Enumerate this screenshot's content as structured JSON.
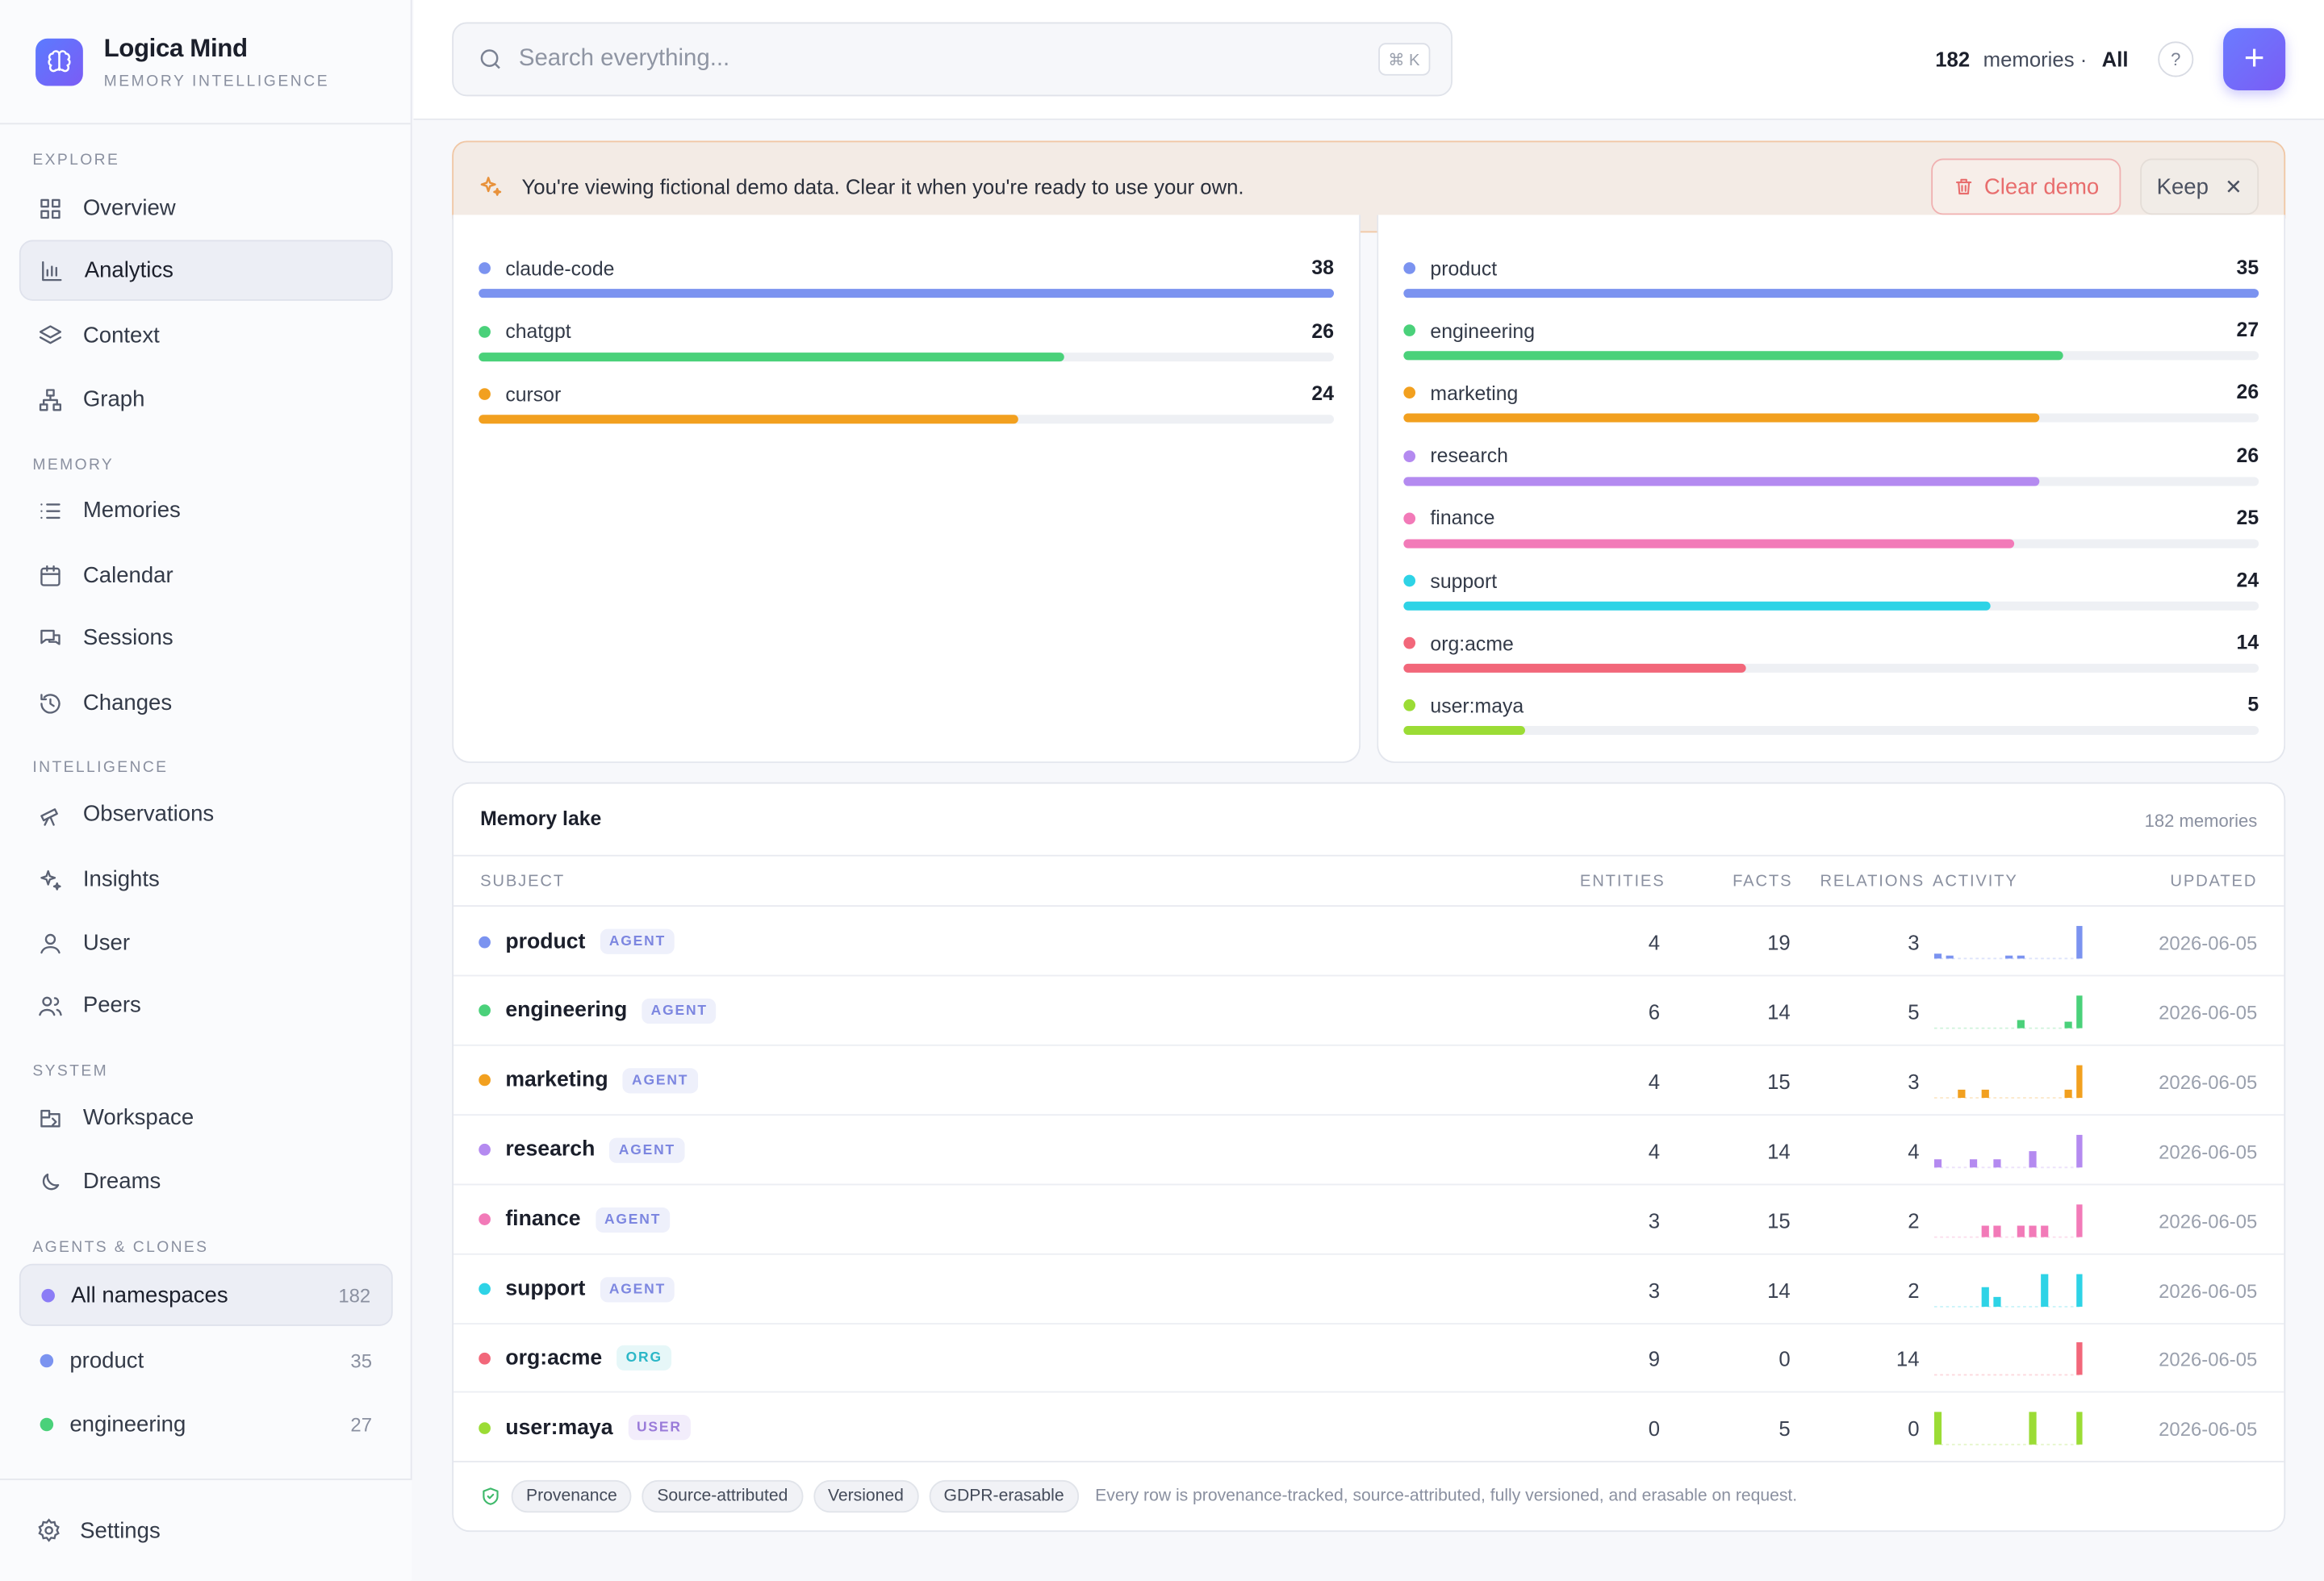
{
  "brand": {
    "title": "Logica Mind",
    "subtitle": "MEMORY INTELLIGENCE"
  },
  "sidebar": {
    "sections": [
      "EXPLORE",
      "MEMORY",
      "INTELLIGENCE",
      "SYSTEM",
      "AGENTS & CLONES"
    ],
    "explore": [
      {
        "label": "Overview",
        "icon": "grid-icon"
      },
      {
        "label": "Analytics",
        "icon": "bar-chart-icon",
        "active": true
      },
      {
        "label": "Context",
        "icon": "layers-icon"
      },
      {
        "label": "Graph",
        "icon": "graph-icon"
      }
    ],
    "memory": [
      {
        "label": "Memories",
        "icon": "list-icon"
      },
      {
        "label": "Calendar",
        "icon": "calendar-icon"
      },
      {
        "label": "Sessions",
        "icon": "chat-icon"
      },
      {
        "label": "Changes",
        "icon": "history-icon"
      }
    ],
    "intelligence": [
      {
        "label": "Observations",
        "icon": "telescope-icon"
      },
      {
        "label": "Insights",
        "icon": "sparkles-icon"
      },
      {
        "label": "User",
        "icon": "user-icon"
      },
      {
        "label": "Peers",
        "icon": "users-icon"
      }
    ],
    "system": [
      {
        "label": "Workspace",
        "icon": "workspace-icon"
      },
      {
        "label": "Dreams",
        "icon": "moon-icon"
      }
    ],
    "namespaces": [
      {
        "label": "All namespaces",
        "count": "182",
        "color": "#8b7cf6",
        "active": true
      },
      {
        "label": "product",
        "count": "35",
        "color": "#7b93f0"
      },
      {
        "label": "engineering",
        "count": "27",
        "color": "#4ad17a"
      }
    ],
    "settings_label": "Settings"
  },
  "header": {
    "search_placeholder": "Search everything...",
    "shortcut": "⌘ K",
    "memory_count": "182",
    "memory_label": "memories ·",
    "scope": "All",
    "help": "?",
    "add": "+"
  },
  "banner": {
    "text": "You're viewing fictional demo data. Clear it when you're ready to use your own.",
    "clear_label": "Clear demo",
    "keep_label": "Keep",
    "accent": "#e8913a"
  },
  "sources": [
    {
      "label": "claude-code",
      "value": 38,
      "color": "#7b93f0"
    },
    {
      "label": "chatgpt",
      "value": 26,
      "color": "#4ad17a"
    },
    {
      "label": "cursor",
      "value": 24,
      "color": "#f2a01f"
    }
  ],
  "namespaces_chart": [
    {
      "label": "product",
      "value": 35,
      "color": "#7b93f0"
    },
    {
      "label": "engineering",
      "value": 27,
      "color": "#4ad17a"
    },
    {
      "label": "marketing",
      "value": 26,
      "color": "#f2a01f"
    },
    {
      "label": "research",
      "value": 26,
      "color": "#b48af0"
    },
    {
      "label": "finance",
      "value": 25,
      "color": "#f27ab8"
    },
    {
      "label": "support",
      "value": 24,
      "color": "#2ed3e6"
    },
    {
      "label": "org:acme",
      "value": 14,
      "color": "#f2677a"
    },
    {
      "label": "user:maya",
      "value": 5,
      "color": "#9bdc35"
    }
  ],
  "lake": {
    "title": "Memory lake",
    "count": "182 memories",
    "columns": {
      "subject": "SUBJECT",
      "entities": "ENTITIES",
      "facts": "FACTS",
      "relations": "RELATIONS",
      "activity": "ACTIVITY",
      "updated": "UPDATED"
    },
    "rows": [
      {
        "name": "product",
        "tag": "AGENT",
        "kind": "agent",
        "entities": "4",
        "facts": "19",
        "relations": "3",
        "updated": "2026-06-05",
        "color": "#7b93f0",
        "activity": [
          0.15,
          0.08,
          0,
          0,
          0,
          0,
          0.08,
          0.08,
          0,
          0,
          0,
          0,
          1
        ]
      },
      {
        "name": "engineering",
        "tag": "AGENT",
        "kind": "agent",
        "entities": "6",
        "facts": "14",
        "relations": "5",
        "updated": "2026-06-05",
        "color": "#4ad17a",
        "activity": [
          0,
          0,
          0,
          0,
          0,
          0,
          0,
          0.25,
          0,
          0,
          0,
          0.2,
          1
        ]
      },
      {
        "name": "marketing",
        "tag": "AGENT",
        "kind": "agent",
        "entities": "4",
        "facts": "15",
        "relations": "3",
        "updated": "2026-06-05",
        "color": "#f2a01f",
        "activity": [
          0,
          0,
          0.25,
          0,
          0.25,
          0,
          0,
          0,
          0,
          0,
          0,
          0.25,
          1
        ]
      },
      {
        "name": "research",
        "tag": "AGENT",
        "kind": "agent",
        "entities": "4",
        "facts": "14",
        "relations": "4",
        "updated": "2026-06-05",
        "color": "#b48af0",
        "activity": [
          0.25,
          0,
          0,
          0.25,
          0,
          0.25,
          0,
          0,
          0.5,
          0,
          0,
          0,
          1
        ]
      },
      {
        "name": "finance",
        "tag": "AGENT",
        "kind": "agent",
        "entities": "3",
        "facts": "15",
        "relations": "2",
        "updated": "2026-06-05",
        "color": "#f27ab8",
        "activity": [
          0,
          0,
          0,
          0,
          0.35,
          0.35,
          0,
          0.35,
          0.35,
          0.35,
          0,
          0,
          1
        ]
      },
      {
        "name": "support",
        "tag": "AGENT",
        "kind": "agent",
        "entities": "3",
        "facts": "14",
        "relations": "2",
        "updated": "2026-06-05",
        "color": "#2ed3e6",
        "activity": [
          0,
          0,
          0,
          0,
          0.6,
          0.3,
          0,
          0,
          0,
          1,
          0,
          0,
          1
        ]
      },
      {
        "name": "org:acme",
        "tag": "ORG",
        "kind": "org",
        "entities": "9",
        "facts": "0",
        "relations": "14",
        "updated": "2026-06-05",
        "color": "#f2677a",
        "activity": [
          0,
          0,
          0,
          0,
          0,
          0,
          0,
          0,
          0,
          0,
          0,
          0,
          1
        ]
      },
      {
        "name": "user:maya",
        "tag": "USER",
        "kind": "user",
        "entities": "0",
        "facts": "5",
        "relations": "0",
        "updated": "2026-06-05",
        "color": "#9bdc35",
        "activity": [
          1,
          0,
          0,
          0,
          0,
          0,
          0,
          0,
          1,
          0,
          0,
          0,
          1
        ]
      }
    ],
    "chips": [
      "Provenance",
      "Source-attributed",
      "Versioned",
      "GDPR-erasable"
    ],
    "footnote": "Every row is provenance-tracked, source-attributed, fully versioned, and erasable on request."
  }
}
